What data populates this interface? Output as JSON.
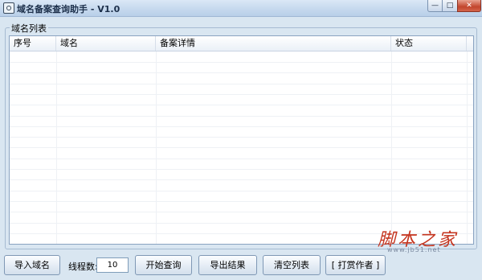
{
  "window": {
    "title": "域名备案查询助手 - V1.0",
    "controls": {
      "minimize": "—",
      "maximize": "□",
      "close": "✕"
    }
  },
  "group": {
    "label": "域名列表"
  },
  "table": {
    "columns": [
      "序号",
      "域名",
      "备案详情",
      "状态"
    ],
    "rows": []
  },
  "toolbar": {
    "import_label": "导入域名",
    "threads_label": "线程数:",
    "threads_value": "10",
    "start_label": "开始查询",
    "export_label": "导出结果",
    "clear_label": "清空列表",
    "donate_label": "[ 打赏作者 ]"
  },
  "watermark": {
    "logo": "脚本之家",
    "url": "www.jb51.net"
  }
}
